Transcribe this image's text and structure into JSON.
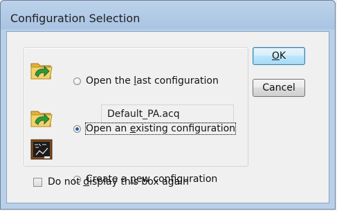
{
  "window": {
    "title": "Configuration Selection"
  },
  "options": [
    {
      "label_pre": "Open the ",
      "label_ul": "l",
      "label_post": "ast configuration",
      "selected": false,
      "icon": "folder-arrow-icon"
    },
    {
      "label_pre": "Open an ",
      "label_ul": "e",
      "label_post": "xisting configuration",
      "selected": true,
      "icon": "folder-arrow-icon"
    },
    {
      "label_pre": "Create a ",
      "label_ul": "n",
      "label_post": "ew configuration",
      "selected": false,
      "icon": "chalkboard-icon"
    }
  ],
  "last_config_file": "Default_PA.acq",
  "buttons": {
    "ok_ul": "O",
    "ok_rest": "K",
    "cancel": "Cancel"
  },
  "checkbox": {
    "pre": "Do not ",
    "ul": "d",
    "post": "isplay this box again",
    "checked": false
  },
  "colors": {
    "title_bar": "#a9c4e3",
    "client_bg": "#f0f0f0",
    "default_button_border": "#3c7fb1",
    "radio_dot": "#2a60a8"
  }
}
